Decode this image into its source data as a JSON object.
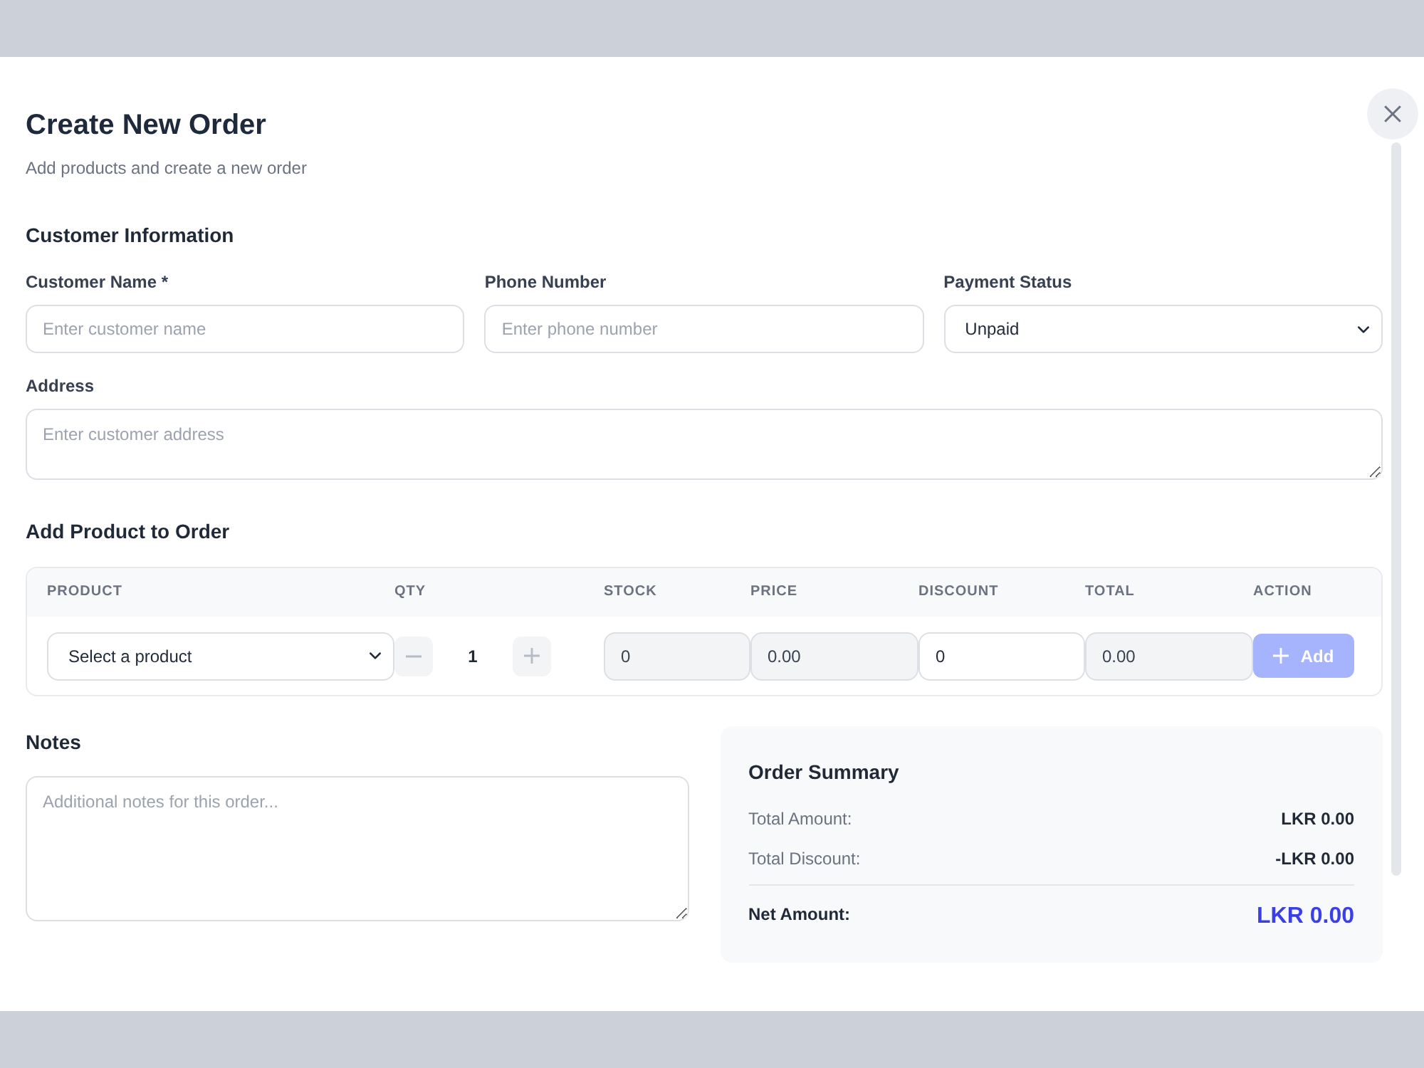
{
  "dialog": {
    "title": "Create New Order",
    "subtitle": "Add products and create a new order"
  },
  "customer_information": {
    "heading": "Customer Information",
    "fields": [
      {
        "kind": "input",
        "label": "Customer Name *",
        "placeholder": "Enter customer name"
      },
      {
        "kind": "input",
        "label": "Phone Number",
        "placeholder": "Enter phone number"
      },
      {
        "kind": "select",
        "label": "Payment Status",
        "value": "Unpaid"
      }
    ],
    "address": {
      "label": "Address",
      "placeholder": "Enter customer address"
    }
  },
  "add_product": {
    "heading": "Add Product to Order",
    "columns": [
      "PRODUCT",
      "QTY",
      "STOCK",
      "PRICE",
      "DISCOUNT",
      "TOTAL",
      "ACTION"
    ],
    "row": [
      {
        "kind": "select",
        "value": "Select a product"
      },
      {
        "kind": "stepper",
        "value": "1"
      },
      {
        "kind": "input",
        "value": "0",
        "disabled": true
      },
      {
        "kind": "input",
        "value": "0.00",
        "disabled": true
      },
      {
        "kind": "input",
        "value": "0",
        "disabled": false
      },
      {
        "kind": "input",
        "value": "0.00",
        "disabled": true
      },
      {
        "kind": "button",
        "label": "Add",
        "disabled": true
      }
    ]
  },
  "notes": {
    "label": "Notes",
    "placeholder": "Additional notes for this order..."
  },
  "order_summary": {
    "title": "Order Summary",
    "rows": [
      {
        "label": "Total Amount:",
        "value": "LKR 0.00"
      },
      {
        "label": "Total Discount:",
        "value": "-LKR 0.00"
      }
    ],
    "net_amount": {
      "label": "Net Amount:",
      "value": "LKR 0.00"
    }
  }
}
